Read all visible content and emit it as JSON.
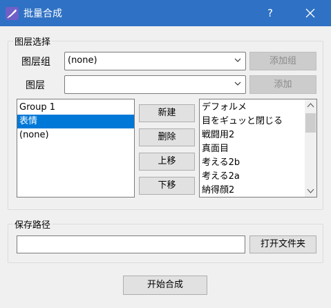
{
  "window": {
    "title": "批量合成",
    "help_glyph": "?"
  },
  "layer_section": {
    "title": "图层选择",
    "layer_group_label": "图层组",
    "layer_group_value": "(none)",
    "add_group_button": "添加组",
    "layer_label": "图层",
    "layer_value": "",
    "add_button": "添加"
  },
  "left_list": {
    "items": [
      "Group 1",
      "表情",
      "(none)"
    ],
    "selected": "表情"
  },
  "middle_buttons": {
    "new": "新建",
    "delete": "删除",
    "move_up": "上移",
    "move_down": "下移"
  },
  "right_list": {
    "items": [
      "デフォルメ",
      "目をギュッと閉じる",
      "戦闘用2",
      "真面目",
      "考える2b",
      "考える2a",
      "納得顔2"
    ]
  },
  "save_section": {
    "title": "保存路径",
    "path_value": "",
    "open_folder_button": "打开文件夹"
  },
  "start_button": "开始合成",
  "colors": {
    "titlebar": "#2f71c4",
    "selection": "#0078d7",
    "background": "#f0f0f0"
  },
  "icons": {
    "app": "feather-pen-icon",
    "close": "close-icon",
    "dropdown": "chevron-down-icon",
    "scroll_up": "scroll-up-arrow-icon",
    "scroll_down": "scroll-down-arrow-icon"
  }
}
